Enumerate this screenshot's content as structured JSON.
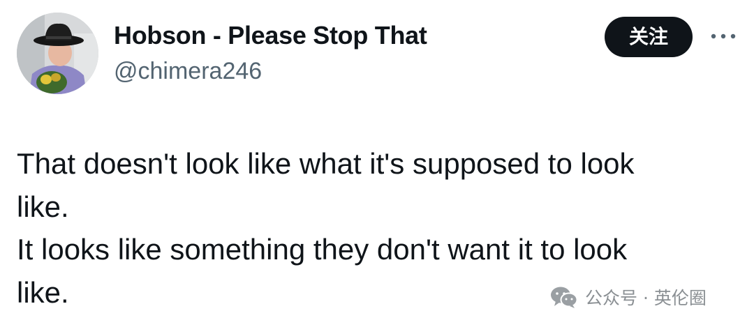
{
  "author": {
    "display_name": "Hobson - Please Stop That",
    "handle": "@chimera246",
    "avatar_icon": "avatar-cowboy-photo"
  },
  "actions": {
    "follow_label": "关注",
    "more_icon": "more-horizontal-icon"
  },
  "tweet": {
    "lines": [
      "That doesn't look like what it's supposed to look",
      "like.",
      "It looks like something they don't want it to look",
      "like."
    ]
  },
  "watermark": {
    "icon": "wechat-icon",
    "text": "公众号 · 英伦圈"
  },
  "colors": {
    "text": "#0f1419",
    "secondary_text": "#536471",
    "follow_button_bg": "#0f1419",
    "follow_button_text": "#ffffff",
    "watermark": "#8a8f93"
  }
}
